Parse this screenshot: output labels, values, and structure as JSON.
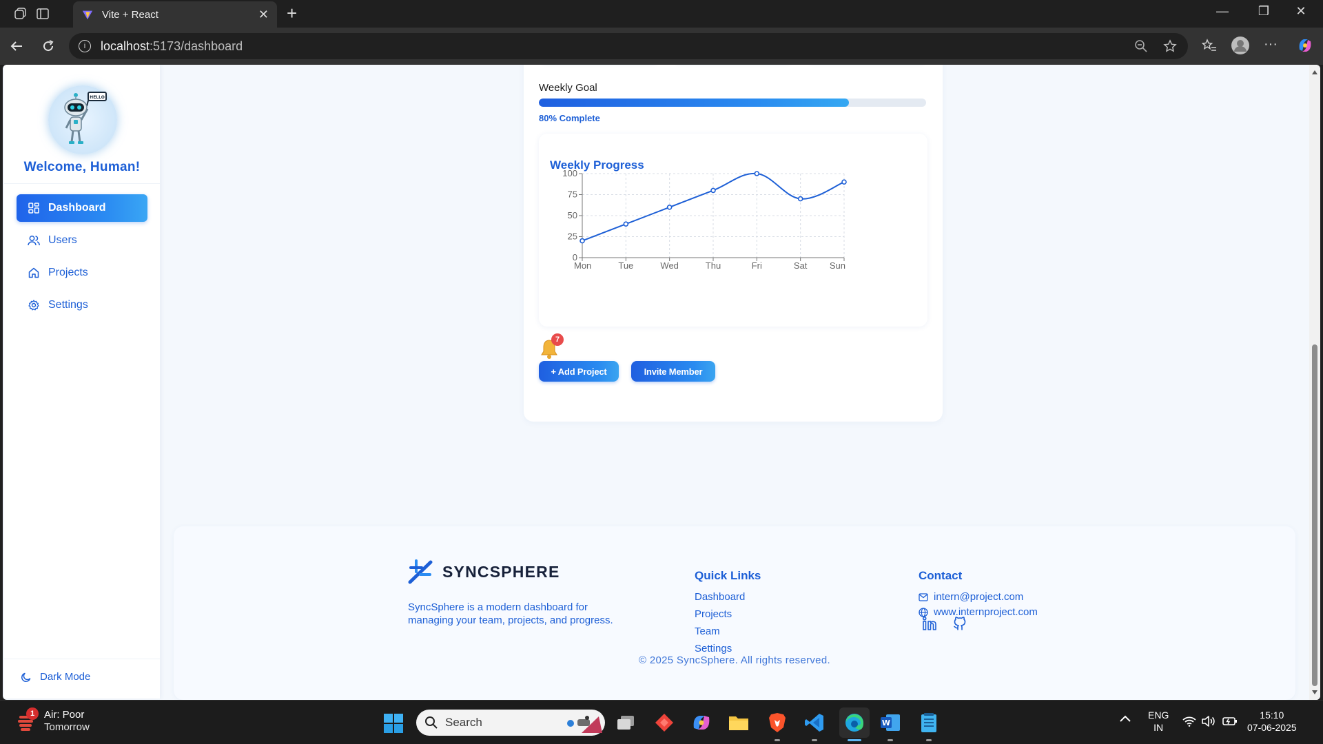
{
  "browser": {
    "tab_title": "Vite + React",
    "url_host": "localhost",
    "url_path": ":5173/dashboard"
  },
  "sidebar": {
    "welcome": "Welcome, Human!",
    "avatar_sign": "HELLO",
    "items": [
      {
        "label": "Dashboard",
        "icon": "dashboard-icon",
        "active": true
      },
      {
        "label": "Users",
        "icon": "users-icon",
        "active": false
      },
      {
        "label": "Projects",
        "icon": "home-icon",
        "active": false
      },
      {
        "label": "Settings",
        "icon": "settings-icon",
        "active": false
      }
    ],
    "dark_mode_label": "Dark Mode"
  },
  "weekly_goal": {
    "label": "Weekly Goal",
    "progress": 0.8,
    "status_text": "80% Complete"
  },
  "chart_data": {
    "type": "line",
    "title": "Weekly Progress",
    "categories": [
      "Mon",
      "Tue",
      "Wed",
      "Thu",
      "Fri",
      "Sat",
      "Sun"
    ],
    "values": [
      20,
      40,
      60,
      80,
      100,
      70,
      90
    ],
    "yticks": [
      "0",
      "25",
      "50",
      "75",
      "100"
    ],
    "ylim": [
      0,
      100
    ],
    "grid": true,
    "color": "#1d5fd6"
  },
  "notifications": {
    "count": "7"
  },
  "actions": {
    "add_project": "+ Add Project",
    "invite_member": "Invite Member"
  },
  "footer": {
    "brand": "SYNCSPHERE",
    "description": "SyncSphere is a modern dashboard for managing your team, projects, and progress.",
    "quick_links_heading": "Quick Links",
    "quick_links": [
      "Dashboard",
      "Projects",
      "Team",
      "Settings"
    ],
    "contact_heading": "Contact",
    "email": "intern@project.com",
    "website": "www.internproject.com",
    "copyright": "© 2025 SyncSphere. All rights reserved."
  },
  "taskbar": {
    "weather_title": "Air: Poor",
    "weather_sub": "Tomorrow",
    "weather_badge": "1",
    "search_placeholder": "Search",
    "lang_top": "ENG",
    "lang_bottom": "IN",
    "time": "15:10",
    "date": "07-06-2025"
  },
  "colors": {
    "accent": "#1d5fd6",
    "accent_light": "#3aa6f4",
    "badge": "#e84b4b"
  }
}
